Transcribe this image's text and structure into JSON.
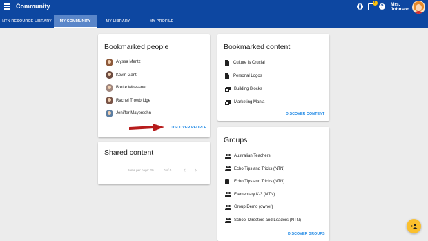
{
  "app": {
    "title": "Community"
  },
  "header": {
    "user_name_line1": "Mrs.",
    "user_name_line2": "Johnson",
    "notification_count": "0",
    "help_glyph": "?"
  },
  "tabs": [
    {
      "label": "NTN RESOURCE LIBRARY",
      "active": false
    },
    {
      "label": "MY COMMUNITY",
      "active": true
    },
    {
      "label": "MY LIBRARY",
      "active": false
    },
    {
      "label": "MY PROFILE",
      "active": false
    }
  ],
  "bookmarked_people": {
    "title": "Bookmarked people",
    "people": [
      {
        "name": "Alyssa Mentz",
        "avatar_color": "#8d5a3b"
      },
      {
        "name": "Kevin Gant",
        "avatar_color": "#6d4c41"
      },
      {
        "name": "Brette Woessner",
        "avatar_color": "#a1887f"
      },
      {
        "name": "Rachel Trowbridge",
        "avatar_color": "#795548"
      },
      {
        "name": "Jeniffer Mayersohn",
        "avatar_color": "#5d7fa3"
      }
    ],
    "action_label": "DISCOVER PEOPLE"
  },
  "shared_content": {
    "title": "Shared content",
    "items_per_page_label": "Items per page: 20",
    "range_label": "0 of 0"
  },
  "bookmarked_content": {
    "title": "Bookmarked content",
    "items": [
      {
        "label": "Culture is Crucial",
        "icon": "document-icon"
      },
      {
        "label": "Personal Logos",
        "icon": "document-icon"
      },
      {
        "label": "Building Blocks",
        "icon": "collection-icon"
      },
      {
        "label": "Marketing Mania",
        "icon": "collection-icon"
      }
    ],
    "action_label": "DISCOVER CONTENT"
  },
  "groups": {
    "title": "Groups",
    "items": [
      {
        "label": "Australian Teachers",
        "icon": "group-icon"
      },
      {
        "label": "Echo Tips and Tricks (NTN)",
        "icon": "group-icon"
      },
      {
        "label": "Echo Tips and Tricks (NTN)",
        "icon": "book-icon"
      },
      {
        "label": "Elementary K-3 (NTN)",
        "icon": "group-icon"
      },
      {
        "label": "Group Demo (owner)",
        "icon": "group-icon"
      },
      {
        "label": "School Directors and Leaders (NTN)",
        "icon": "group-icon"
      }
    ],
    "action_label": "DISCOVER GROUPS"
  },
  "colors": {
    "app_bar": "#0d47a1",
    "active_tab": "#5a86c9",
    "link": "#1e88e5",
    "fab": "#fbc02d",
    "arrow": "#b71c1c"
  }
}
